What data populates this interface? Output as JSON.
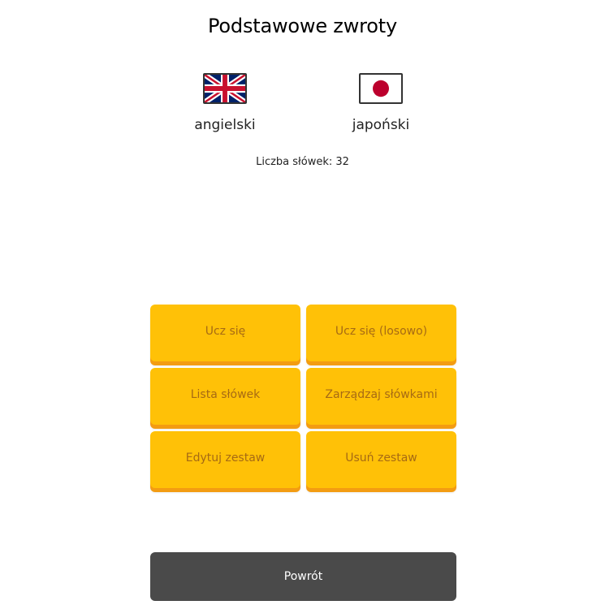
{
  "header": {
    "title": "Podstawowe zwroty"
  },
  "languages": {
    "source": {
      "name": "angielski",
      "flag_icon": "uk-flag-icon"
    },
    "target": {
      "name": "japoński",
      "flag_icon": "japan-flag-icon"
    }
  },
  "stats": {
    "word_count_text": "Liczba słówek: 32"
  },
  "actions": {
    "learn": "Ucz się",
    "learn_random": "Ucz się (losowo)",
    "word_list": "Lista słówek",
    "manage_words": "Zarządzaj słówkami",
    "edit_set": "Edytuj zestaw",
    "delete_set": "Usuń zestaw",
    "back": "Powrót"
  },
  "colors": {
    "button_bg": "#ffc107",
    "button_shadow": "#f39c12",
    "button_text": "#a66a14",
    "back_button_bg": "#4a4a4a"
  }
}
